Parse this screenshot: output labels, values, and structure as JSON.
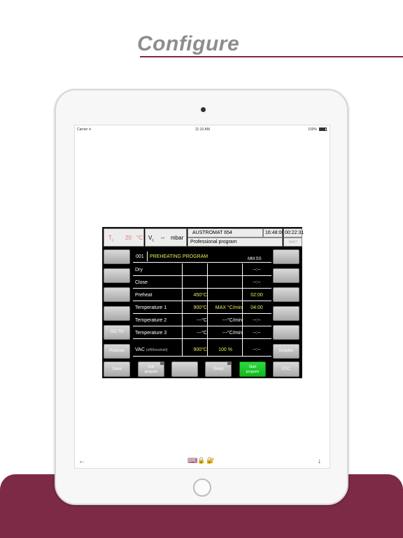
{
  "headline": "Configure",
  "statusbar": {
    "carrier": "Carrier ✈",
    "time": "11:10 AM",
    "battery": "100%"
  },
  "header": {
    "tc_label": "T",
    "tc_sub": "c",
    "tc_value": "20",
    "tc_unit": "°C",
    "vc_label": "V",
    "vc_sub": "c",
    "vc_value": "--",
    "vc_unit": "mbar",
    "model": "AUSTROMAT 654",
    "clock": "16:48:00",
    "elapsed": "00:22:31",
    "program_type": "Professional program",
    "wait": "WAIT"
  },
  "program": {
    "number": "001",
    "name": "PREHEATING PROGRAM",
    "time_unit": "MM:SS"
  },
  "rows": [
    {
      "label": "Dry",
      "note": "",
      "temp": "",
      "rate": "",
      "time": "--:--"
    },
    {
      "label": "Close",
      "note": "",
      "temp": "",
      "rate": "",
      "time": "--:--"
    },
    {
      "label": "Preheat",
      "note": "",
      "temp": "450°C",
      "rate": "",
      "time": "02:00"
    },
    {
      "label": "Temperature 1",
      "note": "",
      "temp": "900°C",
      "rate": "MAX °C/min",
      "time": "04:00"
    },
    {
      "label": "Temperature 2",
      "note": "",
      "temp": "---°C",
      "rate": "---°C/min",
      "time": "--:--"
    },
    {
      "label": "Temperature 3",
      "note": "",
      "temp": "---°C",
      "rate": "---°C/min",
      "time": "--:--"
    },
    {
      "label": "VAC",
      "note": "(off/threshold)",
      "temp": "900°C",
      "rate": "100 %",
      "time": "--:--"
    }
  ],
  "left_buttons": [
    "",
    "",
    "",
    "",
    "GO TO",
    "Pictures"
  ],
  "right_buttons": [
    "",
    "",
    "",
    "",
    "",
    "Graphic"
  ],
  "bottom_buttons": {
    "save": "Save",
    "edit_line1": "Edit",
    "edit_line2": "program",
    "blank": "",
    "sleep": "Sleep",
    "start_line1": "Start",
    "start_line2": "program",
    "esc": "ESC"
  },
  "toolbar": {
    "left_arrow": "←",
    "keyboard": "⌨",
    "lock": "🔒",
    "lock_alt": "🔐",
    "down_arrow": "↓"
  },
  "colors": {
    "brand": "#7c2a46",
    "value_yellow": "#ecec50",
    "start_green": "#1fc92d"
  }
}
